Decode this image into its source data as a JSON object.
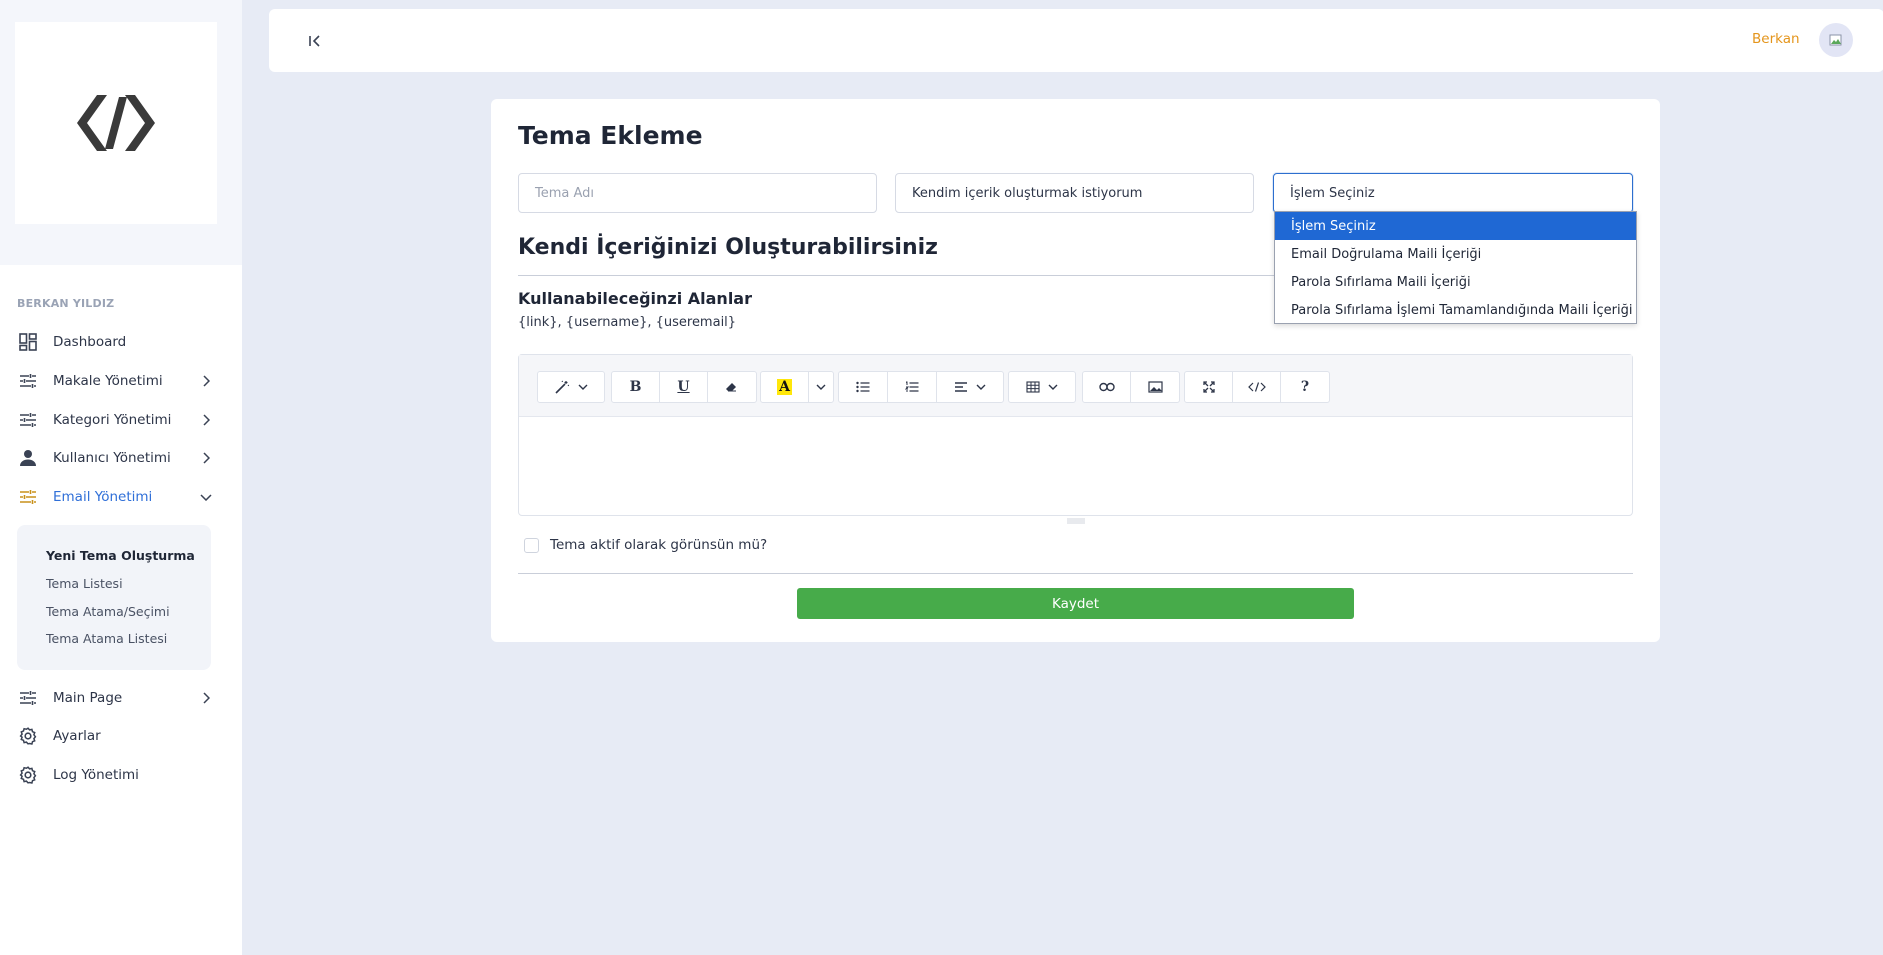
{
  "sidebar": {
    "section_label": "BERKAN YILDIZ",
    "items": [
      {
        "label": "Dashboard",
        "icon": "dashboard-icon"
      },
      {
        "label": "Makale Yönetimi",
        "icon": "tune-icon"
      },
      {
        "label": "Kategori Yönetimi",
        "icon": "tune-icon"
      },
      {
        "label": "Kullanıcı Yönetimi",
        "icon": "person-icon"
      },
      {
        "label": "Email Yönetimi",
        "icon": "tune-icon"
      },
      {
        "label": "Main Page",
        "icon": "tune-icon"
      },
      {
        "label": "Ayarlar",
        "icon": "gear-icon"
      },
      {
        "label": "Log Yönetimi",
        "icon": "gear-icon"
      }
    ],
    "submenu": [
      {
        "label": "Yeni Tema Oluşturma"
      },
      {
        "label": "Tema Listesi"
      },
      {
        "label": "Tema Atama/Seçimi"
      },
      {
        "label": "Tema Atama Listesi"
      }
    ]
  },
  "header": {
    "user_name": "Berkan"
  },
  "form": {
    "title": "Tema Ekleme",
    "theme_name_placeholder": "Tema Adı",
    "content_mode_value": "Kendim içerik oluşturmak istiyorum",
    "action_select_value": "İşlem Seçiniz",
    "action_options": [
      "İşlem Seçiniz",
      "Email Doğrulama Maili İçeriği",
      "Parola Sıfırlama Maili İçeriği",
      "Parola Sıfırlama İşlemi Tamamlandığında Maili İçeriği"
    ],
    "section_title": "Kendi İçeriğinizi Oluşturabilirsiniz",
    "fields_title": "Kullanabileceğinzi Alanlar",
    "fields_list": "{link}, {username}, {useremail}",
    "checkbox_label": "Tema aktif olarak görünsün mü?",
    "save_label": "Kaydet"
  },
  "colors": {
    "accent": "#2f6fd8",
    "user_name": "#e4951c",
    "save_button": "#47ab4a",
    "dropdown_selected": "#1f68d4",
    "background": "#e7ebf5"
  }
}
